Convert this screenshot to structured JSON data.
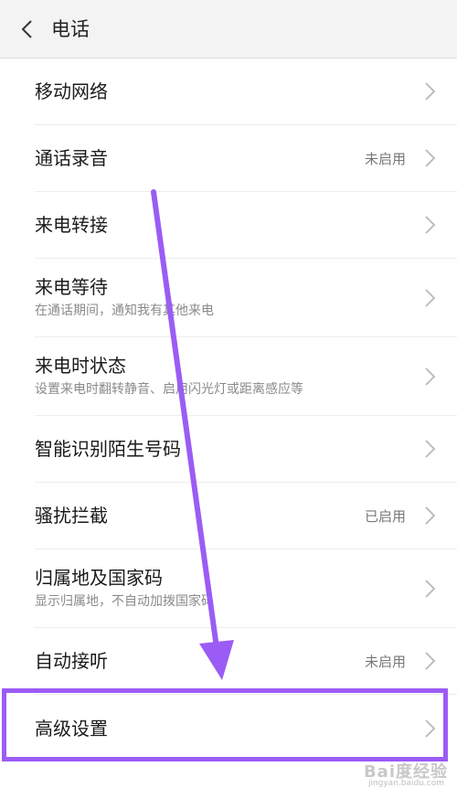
{
  "header": {
    "title": "电话",
    "back_icon": "chevron-left-icon"
  },
  "rows": [
    {
      "title": "移动网络",
      "subtitle": "",
      "status": ""
    },
    {
      "title": "通话录音",
      "subtitle": "",
      "status": "未启用"
    },
    {
      "title": "来电转接",
      "subtitle": "",
      "status": ""
    },
    {
      "title": "来电等待",
      "subtitle": "在通话期间，通知我有其他来电",
      "status": ""
    },
    {
      "title": "来电时状态",
      "subtitle": "设置来电时翻转静音、启用闪光灯或距离感应等",
      "status": ""
    },
    {
      "title": "智能识别陌生号码",
      "subtitle": "",
      "status": ""
    },
    {
      "title": "骚扰拦截",
      "subtitle": "",
      "status": "已启用"
    },
    {
      "title": "归属地及国家码",
      "subtitle": "显示归属地，不自动加拨国家码",
      "status": ""
    },
    {
      "title": "自动接听",
      "subtitle": "",
      "status": "未启用"
    },
    {
      "title": "高级设置",
      "subtitle": "",
      "status": ""
    }
  ],
  "annotation": {
    "color": "#9b5cf5"
  },
  "watermark": {
    "text": "Bai度经验",
    "sub": "jingyan.baidu.com"
  }
}
